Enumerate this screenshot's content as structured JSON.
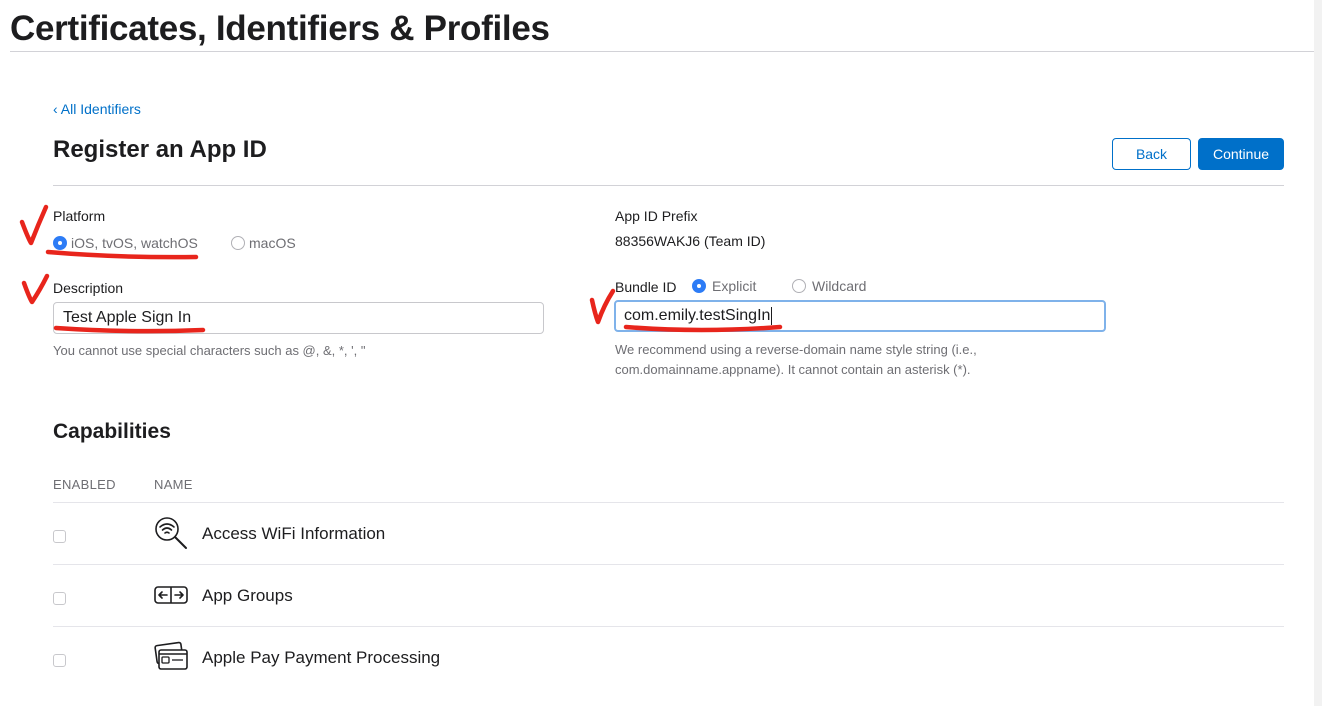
{
  "header": {
    "title": "Certificates, Identifiers & Profiles"
  },
  "nav": {
    "back_link": "‹ All Identifiers"
  },
  "page": {
    "title": "Register an App ID"
  },
  "actions": {
    "back_label": "Back",
    "continue_label": "Continue"
  },
  "platform": {
    "label": "Platform",
    "options": [
      {
        "label": "iOS, tvOS, watchOS",
        "selected": true
      },
      {
        "label": "macOS",
        "selected": false
      }
    ]
  },
  "app_id_prefix": {
    "label": "App ID Prefix",
    "value": "88356WAKJ6 (Team ID)"
  },
  "description": {
    "label": "Description",
    "value": "Test Apple Sign In",
    "help": "You cannot use special characters such as @, &, *, ', \""
  },
  "bundle_id": {
    "label": "Bundle ID",
    "options": [
      {
        "label": "Explicit",
        "selected": true
      },
      {
        "label": "Wildcard",
        "selected": false
      }
    ],
    "value": "com.emily.testSingIn",
    "help_line1": "We recommend using a reverse-domain name style string (i.e.,",
    "help_line2": "com.domainname.appname). It cannot contain an asterisk (*)."
  },
  "capabilities": {
    "title": "Capabilities",
    "columns": {
      "enabled": "ENABLED",
      "name": "NAME"
    },
    "items": [
      {
        "name": "Access WiFi Information",
        "icon": "wifi-search-icon",
        "enabled": false
      },
      {
        "name": "App Groups",
        "icon": "app-groups-icon",
        "enabled": false
      },
      {
        "name": "Apple Pay Payment Processing",
        "icon": "apple-pay-cards-icon",
        "enabled": false
      }
    ]
  },
  "colors": {
    "accent": "#0070c9",
    "annotation": "#e8251c",
    "radio_selected": "#2d7cf6"
  }
}
